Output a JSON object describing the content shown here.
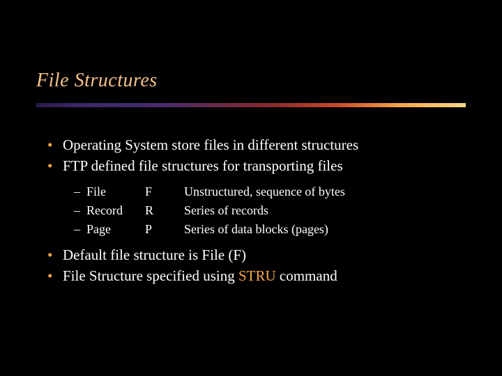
{
  "title": "File Structures",
  "bullets": {
    "b1": "Operating System store files in different structures",
    "b2": "FTP defined file structures for transporting files",
    "b3": "Default file structure is File (F)",
    "b4_pre": "File Structure specified using ",
    "b4_cmd": "STRU",
    "b4_post": " command"
  },
  "sub": [
    {
      "name": "File",
      "code": "F",
      "desc": "Unstructured, sequence of bytes"
    },
    {
      "name": "Record",
      "code": "R",
      "desc": "Series of records"
    },
    {
      "name": "Page",
      "code": "P",
      "desc": "Series of data blocks (pages)"
    }
  ]
}
